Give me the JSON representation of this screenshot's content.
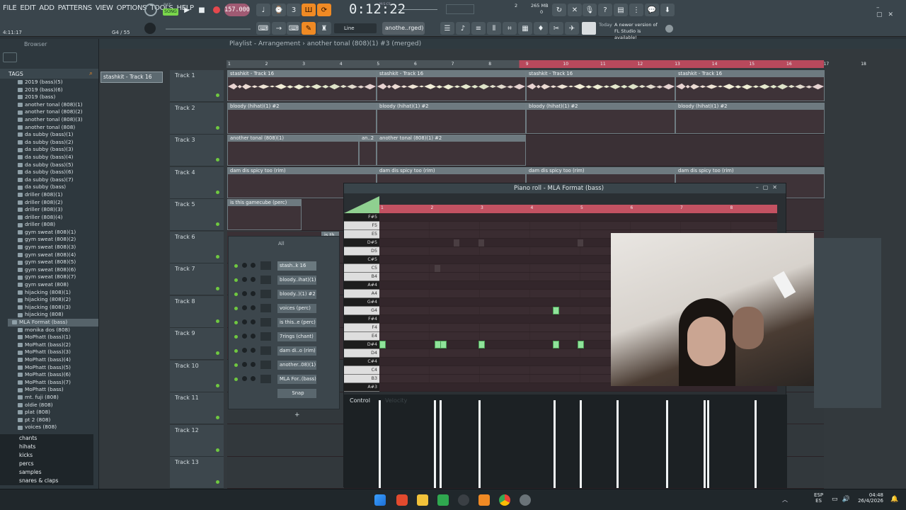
{
  "menu": [
    "FILE",
    "EDIT",
    "ADD",
    "PATTERNS",
    "VIEW",
    "OPTIONS",
    "TOOLS",
    "HELP"
  ],
  "transport": {
    "song_mode": "SONG",
    "pat_mode": "PAT",
    "tempo": "157.000",
    "time": "0:12:22",
    "time_label": "M:S:CS",
    "beat": "4:11:17",
    "memory": "265 MB",
    "mem_value": "0",
    "cpu": "2",
    "hint_note": "G4 / 55",
    "snap_mode": "Line",
    "pattern_select": "anothe..rged)"
  },
  "notice": {
    "today": "Today",
    "text": "A newer version of FL Studio is available!"
  },
  "browser": {
    "title": "Browser",
    "tags_label": "TAGS",
    "items": [
      "2019 (bass)(5)",
      "2019 (bass)(6)",
      "2019 (bass)",
      "another tonal (808)(1)",
      "another tonal (808)(2)",
      "another tonal (808)(3)",
      "another tonal (808)",
      "da subby (bass)(1)",
      "da subby (bass)(2)",
      "da subby (bass)(3)",
      "da subby (bass)(4)",
      "da subby (bass)(5)",
      "da subby (bass)(6)",
      "da subby (bass)(7)",
      "da subby (bass)",
      "driller (808)(1)",
      "driller (808)(2)",
      "driller (808)(3)",
      "driller (808)(4)",
      "driller (808)",
      "gym sweat (808)(1)",
      "gym sweat (808)(2)",
      "gym sweat (808)(3)",
      "gym sweat (808)(4)",
      "gym sweat (808)(5)",
      "gym sweat (808)(6)",
      "gym sweat (808)(7)",
      "gym sweat (808)",
      "hijacking (808)(1)",
      "hijacking (808)(2)",
      "hijacking (808)(3)",
      "hijacking (808)",
      "MLA Format (bass)",
      "monika dos (808)",
      "MoPhatt (bass)(1)",
      "MoPhatt (bass)(2)",
      "MoPhatt (bass)(3)",
      "MoPhatt (bass)(4)",
      "MoPhatt (bass)(5)",
      "MoPhatt (bass)(6)",
      "MoPhatt (bass)(7)",
      "MoPhatt (bass)",
      "mt. fuji (808)",
      "oldie (808)",
      "plat (808)",
      "pt 2 (808)",
      "voices (808)"
    ],
    "folders": [
      "chants",
      "hihats",
      "kicks",
      "percs",
      "samples",
      "snares & claps"
    ]
  },
  "playlist": {
    "title": "Playlist - Arrangement",
    "crumb": "another tonal (808)(1) #3 (merged)",
    "pattern_btn": "stashkit - Track 16",
    "ruler": [
      "1",
      "2",
      "3",
      "4",
      "5",
      "6",
      "7",
      "8",
      "9",
      "10",
      "11",
      "12",
      "13",
      "14",
      "15",
      "16",
      "17",
      "18"
    ],
    "tracks": [
      "Track 1",
      "Track 2",
      "Track 3",
      "Track 4",
      "Track 5",
      "Track 6",
      "Track 7",
      "Track 8",
      "Track 9",
      "Track 10",
      "Track 11",
      "Track 12",
      "Track 13"
    ],
    "clips": {
      "t1": "stashkit - Track 16",
      "t2": "bloody (hihat)(1) #2",
      "t3a": "another tonal (808)(1)",
      "t3b": "an..2",
      "t3c": "another tonal (808)(1) #2",
      "t4": "dam dis spicy too (rim)",
      "t5": "is this gamecube (perc)",
      "t6": "is th"
    }
  },
  "channel_rack": {
    "filter": "All",
    "channels": [
      "stash..k 16",
      "bloody..ihat)(1)",
      "bloody..)(1) #2",
      "voices (perc)",
      "is this..e (perc)",
      "7rings (chant)",
      "dam di..o (rim)",
      "another..08)(1)",
      "MLA For..(bass)",
      "Snap"
    ],
    "add": "+"
  },
  "piano_roll": {
    "title": "Piano roll - MLA Format (bass)",
    "control": "Control",
    "velocity": "Velocity",
    "keys": [
      "F#5",
      "F5",
      "E5",
      "D#5",
      "D5",
      "C#5",
      "C5",
      "B4",
      "A#4",
      "A4",
      "G#4",
      "G4",
      "F#4",
      "F4",
      "E4",
      "D#4",
      "D4",
      "C#4",
      "C4",
      "B3",
      "A#3"
    ],
    "bars": [
      "1",
      "2",
      "3",
      "4",
      "5",
      "6",
      "7",
      "8"
    ]
  },
  "taskbar": {
    "lang": "ESP",
    "lang2": "ES",
    "time": "04:48",
    "date": "26/4/2026"
  }
}
